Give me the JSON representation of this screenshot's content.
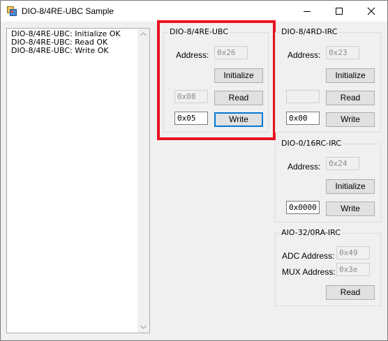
{
  "window": {
    "title": "DIO-8/4RE-UBC Sample",
    "accent_highlight": "#e8131f"
  },
  "log": {
    "lines": [
      "DIO-8/4RE-UBC: Initialize OK",
      "DIO-8/4RE-UBC: Read OK",
      "DIO-8/4RE-UBC: Write OK"
    ]
  },
  "ubc": {
    "title": "DIO-8/4RE-UBC",
    "address_label": "Address:",
    "address_value": "0x26",
    "initialize_label": "Initialize",
    "read_value": "0x08",
    "read_label": "Read",
    "write_value": "0x05",
    "write_label": "Write"
  },
  "ird": {
    "title": "DIO-8/4RD-IRC",
    "address_label": "Address:",
    "address_value": "0x23",
    "initialize_label": "Initialize",
    "read_value": "",
    "read_label": "Read",
    "write_value": "0x00",
    "write_label": "Write"
  },
  "i16": {
    "title": "DIO-0/16RC-IRC",
    "address_label": "Address:",
    "address_value": "0x24",
    "initialize_label": "Initialize",
    "write_value": "0x0000",
    "write_label": "Write"
  },
  "aio": {
    "title": "AIO-32/0RA-IRC",
    "adc_label": "ADC Address:",
    "adc_value": "0x49",
    "mux_label": "MUX Address:",
    "mux_value": "0x3e",
    "read_label": "Read"
  }
}
